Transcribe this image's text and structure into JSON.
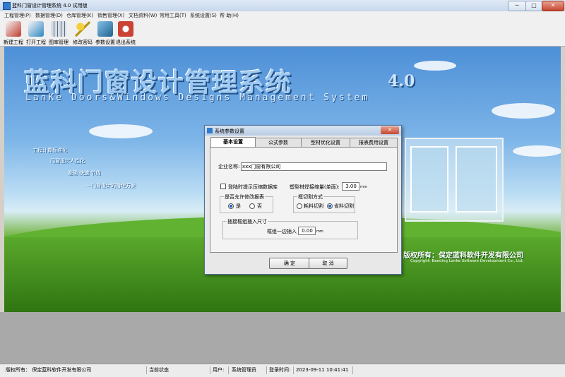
{
  "app": {
    "title": "蓝科门窗设计管理系统 4.0 试用版"
  },
  "window_controls": {
    "minimize": "─",
    "maximize": "□",
    "close": "✕"
  },
  "menu": [
    "工程管理(P)",
    "数据管理(D)",
    "仓库管理(K)",
    "销售管理(X)",
    "文档资料(W)",
    "常用工具(T)",
    "系统设置(S)",
    "帮 助(H)"
  ],
  "toolbar": [
    {
      "label": "新建工程",
      "icon": "new-project-icon",
      "color": "#c0392b"
    },
    {
      "label": "打开工程",
      "icon": "open-project-icon",
      "color": "#2e86c1"
    },
    {
      "label": "图库管理",
      "icon": "library-icon",
      "color": "#5d6d7e"
    },
    {
      "label": "修改密码",
      "icon": "key-icon",
      "color": "#b7950b"
    },
    {
      "label": "参数设置",
      "icon": "settings-icon",
      "color": "#1f618d"
    },
    {
      "label": "退出系统",
      "icon": "exit-icon",
      "color": "#cb4335"
    }
  ],
  "banner": {
    "title_cn": "蓝科门窗设计管理系统",
    "version": "4.0",
    "title_en": "LanKe Doors&Windows Designs Management System",
    "slogans": [
      "工程计算标准化",
      "门窗设计人性化",
      "准确 快速 节约",
      "一门窗设计的管理方案"
    ],
    "copyright_cn": "版权所有：保定蓝科软件开发有限公司",
    "copyright_en": "Copyright: Baoding Lanke Software Development Co., Ltd."
  },
  "dialog": {
    "title": "系统参数设置",
    "close": "✕",
    "tabs": [
      "基本设置",
      "公式参数",
      "型材优化设置",
      "报表费用设置"
    ],
    "active_tab": 0,
    "company_label": "企业名称:",
    "company_value": "xxx门窗有限公司",
    "compress_label": "登陆时提示压缩数据库",
    "compress_checked": false,
    "shrink_label": "塑型材焊接缩量(单面):",
    "shrink_value": "3.00",
    "shrink_unit": "mm",
    "modify_report": {
      "label": "是否允许修改报表",
      "yes": "是",
      "no": "否",
      "selected": "yes"
    },
    "cut_method": {
      "label": "框切割方式",
      "option1": "耗料切割",
      "option2": "省料切割",
      "selected": "option2"
    },
    "insert": {
      "label": "插接框组插入尺寸",
      "field_label": "框组一边插入",
      "value": "0.00",
      "unit": "mm"
    },
    "ok": "确 定",
    "cancel": "取 消"
  },
  "status": {
    "copyright": "版权所有：  保定蓝科软件开发有限公司",
    "state_label": "当前状态",
    "user_label": "用户:",
    "user_value": "系统管理员",
    "login_label": "登录时间:",
    "login_value": "2023-09-11 10:41:41"
  }
}
